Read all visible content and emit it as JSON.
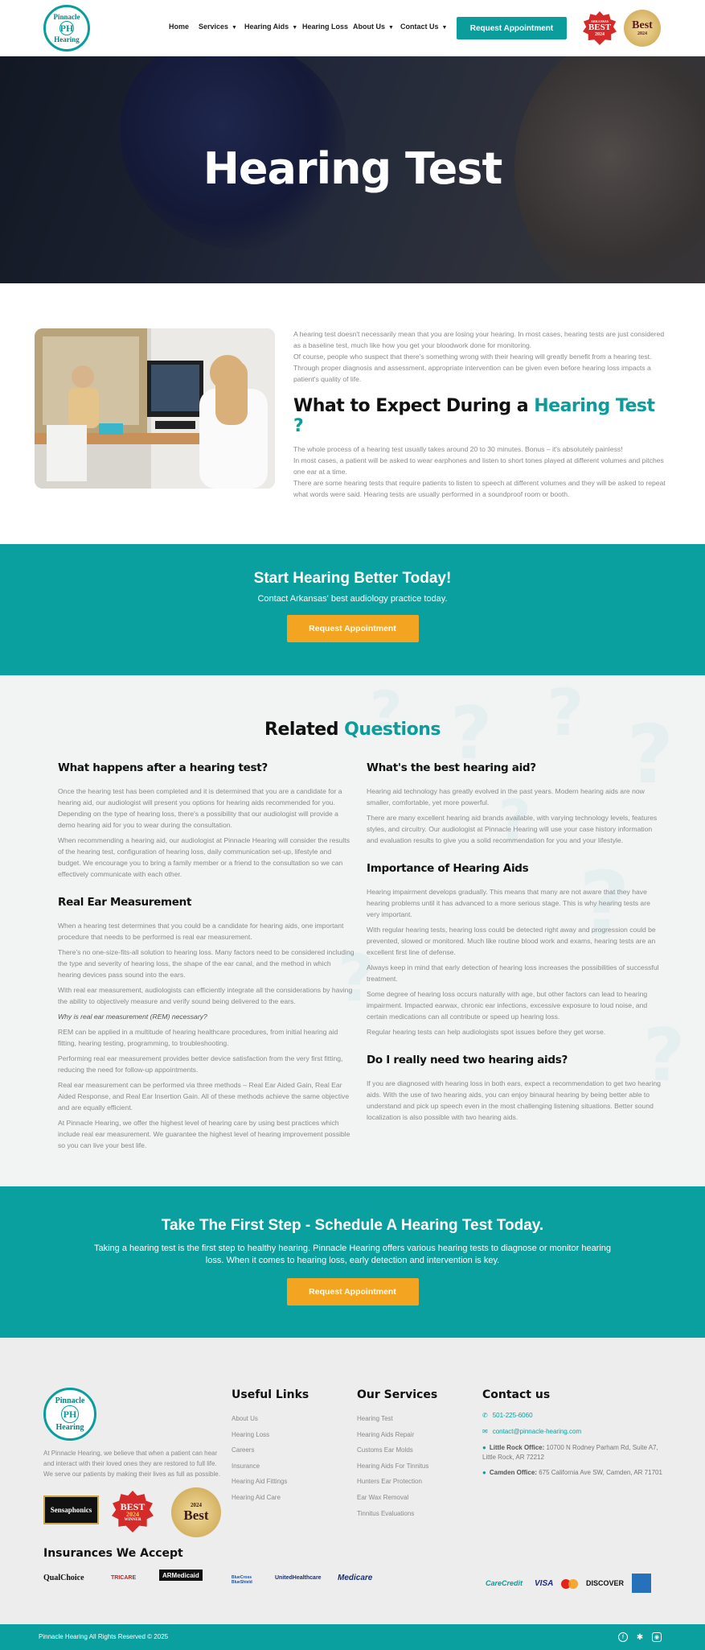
{
  "header": {
    "logo_top": "Pinnacle",
    "logo_mid": "PH",
    "logo_est": "EST",
    "logo_year": "2010",
    "logo_bottom": "Hearing",
    "nav": [
      "Home",
      "Services",
      "Hearing Aids",
      "Hearing Loss",
      "About Us",
      "Contact Us"
    ],
    "cta": "Request Appointment",
    "badge1_top": "ARKANSAS",
    "badge1_main": "BEST",
    "badge1_year": "2024",
    "badge2_main": "Best",
    "badge2_top": "2024"
  },
  "hero": {
    "title": "Hearing Test"
  },
  "intro": {
    "p1": "A hearing test doesn't necessarily mean that you are losing your hearing. In most cases, hearing tests are just considered as a baseline test, much like how you get your bloodwork done for monitoring.",
    "p2": "Of course, people who suspect that there's something wrong with their hearing will greatly benefit from a hearing test. Through proper diagnosis and assessment, appropriate intervention can be given even before hearing loss impacts a patient's quality of life.",
    "heading_a": "What to Expect During a ",
    "heading_b": "Hearing Test ?",
    "p3": "The whole process of a hearing test usually takes around 20 to 30 minutes. Bonus – it's absolutely painless!",
    "p4": "In most cases, a patient will be asked to wear earphones and listen to short tones played at different volumes and pitches one ear at a time.",
    "p5": "There are some hearing tests that require patients to listen to speech at different volumes and they will be asked to repeat what words were said. Hearing tests are usually performed in a soundproof room or booth."
  },
  "cta1": {
    "title": "Start Hearing Better Today!",
    "sub": "Contact Arkansas' best audiology practice today.",
    "button": "Request Appointment"
  },
  "related": {
    "title_a": "Related ",
    "title_b": "Questions",
    "left": {
      "q1": "What happens after a hearing test?",
      "q1p1": "Once the hearing test has been completed and it is determined that you are a candidate for a hearing aid, our audiologist will present you options for hearing aids recommended for you. Depending on the type of hearing loss, there's a possibility that our audiologist will provide a demo hearing aid for you to wear during the consultation.",
      "q1p2": "When recommending a hearing aid, our audiologist at Pinnacle Hearing will consider the results of the hearing test, configuration of hearing loss, daily communication set-up, lifestyle and budget. We encourage you to bring a family member or a friend to the consultation so we can effectively communicate with each other.",
      "q2": "Real Ear Measurement",
      "q2p1": "When a hearing test determines that you could be a candidate for hearing aids, one important procedure that needs to be performed is real ear measurement.",
      "q2p2": "There's no one-size-fits-all solution to hearing loss. Many factors need to be considered including the type and severity of hearing loss, the shape of the ear canal, and the method in which hearing devices pass sound into the ears.",
      "q2p3": "With real ear measurement, audiologists can efficiently integrate all the considerations by having the ability to objectively measure and verify sound being delivered to the ears.",
      "q2p4": "Why is real ear measurement (REM) necessary?",
      "q2p5": "REM can be applied in a multitude of hearing healthcare procedures, from initial hearing aid fitting, hearing testing, programming, to troubleshooting.",
      "q2p6": "Performing real ear measurement provides better device satisfaction from the very first fitting, reducing the need for follow-up appointments.",
      "q2p7": "Real ear measurement can be performed via three methods – Real Ear Aided Gain, Real Ear Aided Response, and Real Ear Insertion Gain. All of these methods achieve the same objective and are equally efficient.",
      "q2p8": "At Pinnacle Hearing, we offer the highest level of hearing care by using best practices which include real ear measurement. We guarantee the highest level of hearing improvement possible so you can live your best life."
    },
    "right": {
      "q3": "What's the best hearing aid?",
      "q3p1": "Hearing aid technology has greatly evolved in the past years. Modern hearing aids are now smaller, comfortable, yet more powerful.",
      "q3p2": "There are many excellent hearing aid brands available, with varying technology levels, features styles, and circuitry. Our audiologist at Pinnacle Hearing will use your case history information and evaluation results to give you a solid recommendation for you and your lifestyle.",
      "q4": "Importance of Hearing Aids",
      "q4p1": "Hearing impairment develops gradually. This means that many are not aware that they have hearing problems until it has advanced to a more serious stage. This is why hearing tests are very important.",
      "q4p2": "With regular hearing tests, hearing loss could be detected right away and progression could be prevented, slowed or monitored. Much like routine blood work and exams, hearing tests are an excellent first line of defense.",
      "q4p3": "Always keep in mind that early detection of hearing loss increases the possibilities of successful treatment.",
      "q4p4": "Some degree of hearing loss occurs naturally with age, but other factors can lead to hearing impairment. Impacted earwax, chronic ear infections, excessive exposure to loud noise, and certain medications can all contribute or speed up hearing loss.",
      "q4p5": "Regular hearing tests can help audiologists spot issues before they get worse.",
      "q5": "Do I really need two hearing aids?",
      "q5p1": "If you are diagnosed with hearing loss in both ears, expect a recommendation to get two hearing aids. With the use of two hearing aids, you can enjoy binaural hearing by being better able to understand and pick up speech even in the most challenging listening situations. Better sound localization is also possible with two hearing aids."
    }
  },
  "cta2": {
    "title": "Take The First Step - Schedule A Hearing Test Today.",
    "sub": "Taking a hearing test is the first step to healthy hearing. Pinnacle Hearing offers various hearing tests to diagnose or monitor hearing loss. When it comes to hearing loss, early detection and intervention is key.",
    "button": "Request Appointment"
  },
  "footer": {
    "about": "At Pinnacle Hearing, we believe that when a patient can hear and interact with their loved ones they are restored to full life. We serve our patients by making their lives as full as possible.",
    "award1": "Sensaphonics",
    "award2_main": "BEST",
    "award2_year": "2024",
    "award2_sub": "WINNER",
    "award3_main": "Best",
    "award3_year": "2024",
    "useful_title": "Useful Links",
    "useful": [
      "About Us",
      "Hearing Loss",
      "Careers",
      "Insurance",
      "Hearing Aid Fittings",
      "Hearing Aid Care"
    ],
    "services_title": "Our Services",
    "services": [
      "Hearing Test",
      "Hearing Aids Repair",
      "Customs Ear Molds",
      "Hearing Aids For Tinnitus",
      "Hunters Ear Protection",
      "Ear Wax Removal",
      "Tinnitus Evaluations"
    ],
    "contact_title": "Contact us",
    "phone": "501-225-6060",
    "email": "contact@pinnacle-hearing.com",
    "lr_label": "Little Rock Office:",
    "lr_addr": "10700 N Rodney Parham Rd, Suite A7, Little Rock, AR 72212",
    "cam_label": "Camden Office:",
    "cam_addr": "675 California Ave SW, Camden, AR 71701",
    "ins_title": "Insurances We Accept",
    "insurers": [
      "QualChoice",
      "TRICARE",
      "ARMedicaid",
      "BlueCross BlueShield",
      "UnitedHealthcare",
      "Medicare"
    ],
    "payments": [
      "CareCredit",
      "VISA",
      "mastercard",
      "DISCOVER",
      "AMERICAN EXPRESS"
    ]
  },
  "bottom": {
    "copyright": "Pinnacle Hearing All Rights Reserved © 2025",
    "social": [
      "facebook-icon",
      "yelp-icon",
      "instagram-icon"
    ]
  },
  "colors": {
    "teal": "#0a9d9c",
    "orange": "#f3a521",
    "dark": "#111111"
  }
}
